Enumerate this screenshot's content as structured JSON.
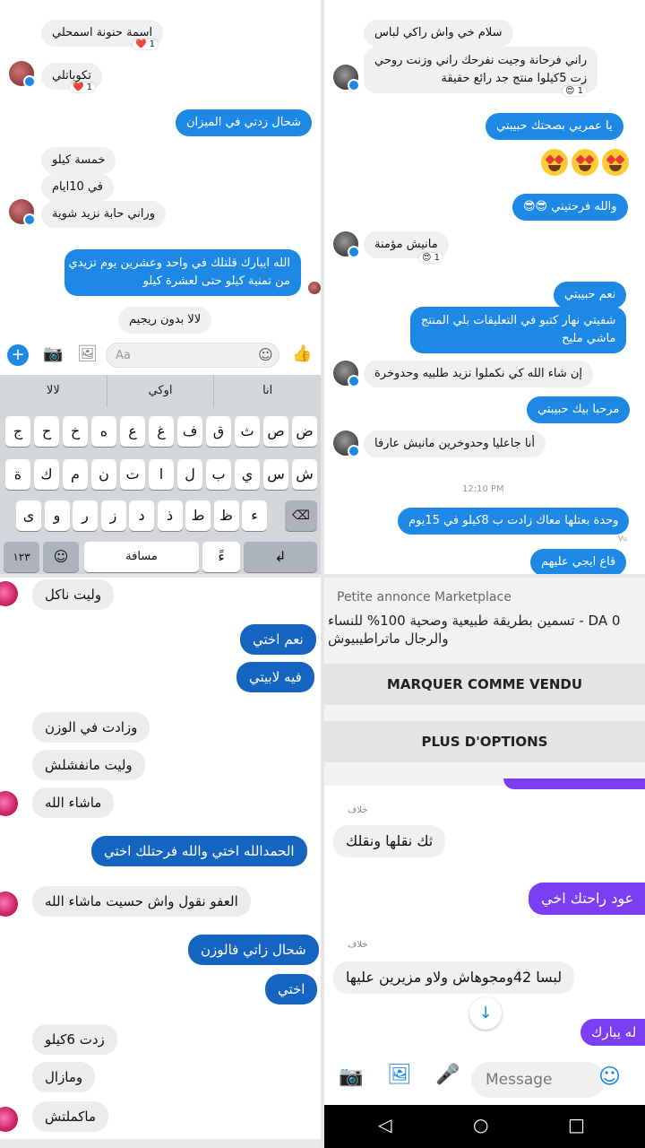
{
  "p1": {
    "msgs": [
      "اسمة حنونة اسمحلي",
      "تكوباتلي",
      "شحال زدتي في الميزان",
      "خمسة كيلو",
      "في 10ايام",
      "وراني حابة نزيد شوية"
    ],
    "long_out_1": "الله ايبارك قلتلك في  واحد وعشرين يوم تزيدي",
    "long_out_2": "من تمنية  كيلو حتى لعشرة كيلو",
    "last_in": "لالا بدون ريجيم",
    "reaction_1": "❤️ 1",
    "reaction_2": "❤️ 1",
    "input_placeholder": "Aa",
    "suggestions": [
      "لالا",
      "اوكي",
      "انا"
    ],
    "row1": [
      "ض",
      "ص",
      "ث",
      "ق",
      "ف",
      "غ",
      "ع",
      "ه",
      "خ",
      "ح",
      "ج"
    ],
    "row2": [
      "ش",
      "س",
      "ي",
      "ب",
      "ل",
      "ا",
      "ت",
      "ن",
      "م",
      "ك",
      "ة"
    ],
    "row3": [
      "ء",
      "ظ",
      "ط",
      "ذ",
      "د",
      "ز",
      "ر",
      "و",
      "ى"
    ],
    "space_label": "مسافة",
    "num_label": "١٢٣",
    "hamza_key": "ءً"
  },
  "p2": {
    "in1": "سلام خي واش راكي لباس",
    "in2a": "راني فرحانة وجيت نفرحك راني وزنت روحي",
    "in2b": "زت 5كيلوا منتج جد رائع حقيقة",
    "react_a": "😍 1",
    "out1": "يا عمريي بصحتك حبيبتي",
    "out2": "والله فرحتيني 😎😎",
    "in3": "مانيش مؤمنة",
    "react_b": "😍 1",
    "out3": "نعم حبيبتي",
    "out4a": "شفيتي نهار كتبو في التعليقات بلي المنتج",
    "out4b": "ماشي مليح",
    "in4": "إن شاء الله كي نكملوا نزيد طلبيه وحدوخرة",
    "out5": "مرحبا بيك حبيبتي",
    "in5": "أنا جاعليا وحدوخرين مانيش عارفا",
    "time": "12:10 PM",
    "out6": "وحدة بعتلها معاك زادت ب 8كيلو في 15يوم",
    "seen": "Vu",
    "out7": "قاع ايجي عليهم"
  },
  "p3": {
    "m1": "وليت ناكل",
    "m2": "نعم اختي",
    "m3": "فيه لابيتي",
    "m4": "وزادت في الوزن",
    "m5": "وليت مانفشلش",
    "m6": "ماشاء الله",
    "m7": "الحمدالله اختي والله فرحتلك اختي",
    "m8": "العفو  نقول واش حسيت ماشاء الله",
    "m9": "شحال زاتي فالوزن",
    "m10": "اختي",
    "m11": "زدت 6كيلو",
    "m12": "ومازال",
    "m13": "ماكملتش"
  },
  "p4": {
    "mp_title": "Petite annonce Marketplace",
    "mp_text": "0 DA - تسمين بطريقة طبيعية وصحية 100% للنساء والرجال ماتراطيبيوش",
    "btn_sold": "MARQUER COMME VENDU",
    "btn_more": "PLUS D'OPTIONS",
    "sender1": "خلاف",
    "in1": "ثك نقلها ونقلك",
    "out1": "عود راحتك اخي",
    "sender2": "خلاف",
    "in2": "لبسا 42ومجوهاش ولاو مزيرين عليها",
    "out2": "له يبارك",
    "message_placeholder": "Message"
  }
}
